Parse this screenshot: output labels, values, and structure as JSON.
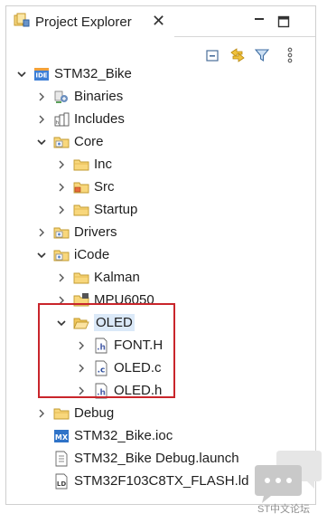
{
  "view": {
    "title": "Project Explorer",
    "close_glyph": "✕"
  },
  "toolbar": {
    "buttons": [
      "collapse-all-icon",
      "link-with-editor-icon",
      "filter-icon",
      "view-menu-icon"
    ]
  },
  "tree": [
    {
      "label": "STM32_Bike",
      "icon": "ide-project-icon",
      "expanded": true
    },
    {
      "label": "Binaries",
      "icon": "binaries-icon",
      "expanded": false
    },
    {
      "label": "Includes",
      "icon": "includes-icon",
      "expanded": false
    },
    {
      "label": "Core",
      "icon": "source-folder-icon",
      "expanded": true
    },
    {
      "label": "Inc",
      "icon": "folder-icon",
      "expanded": false
    },
    {
      "label": "Src",
      "icon": "source-folder-icon",
      "expanded": false
    },
    {
      "label": "Startup",
      "icon": "folder-icon",
      "expanded": false
    },
    {
      "label": "Drivers",
      "icon": "source-folder-icon",
      "expanded": false
    },
    {
      "label": "iCode",
      "icon": "source-folder-icon",
      "expanded": true
    },
    {
      "label": "Kalman",
      "icon": "folder-icon",
      "expanded": false
    },
    {
      "label": "MPU6050",
      "icon": "folder-icon",
      "expanded": false
    },
    {
      "label": "OLED",
      "icon": "folder-open-icon",
      "expanded": true
    },
    {
      "label": "FONT.H",
      "icon": "header-file-icon",
      "expanded": false
    },
    {
      "label": "OLED.c",
      "icon": "c-file-icon",
      "expanded": false
    },
    {
      "label": "OLED.h",
      "icon": "header-file-icon",
      "expanded": false
    },
    {
      "label": "Debug",
      "icon": "folder-icon",
      "expanded": false
    },
    {
      "label": "STM32_Bike.ioc",
      "icon": "mx-file-icon"
    },
    {
      "label": "STM32_Bike Debug.launch",
      "icon": "launch-file-icon"
    },
    {
      "label": "STM32F103C8TX_FLASH.ld",
      "icon": "linker-file-icon"
    }
  ],
  "watermark": {
    "text": "ST中文论坛"
  }
}
